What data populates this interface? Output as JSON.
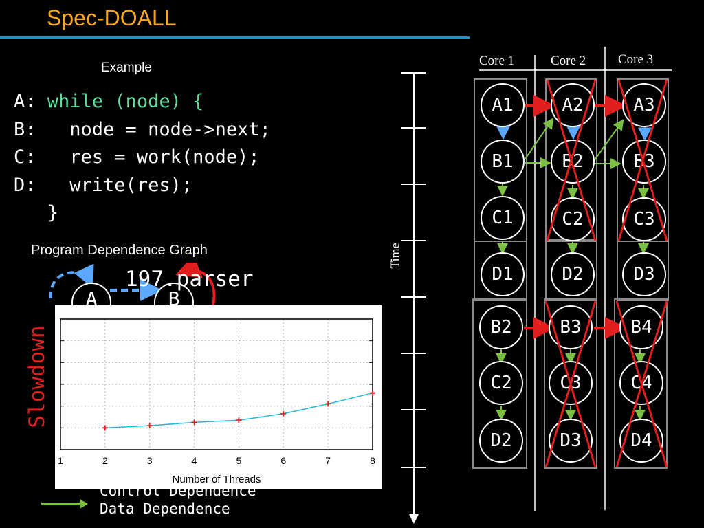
{
  "slide": {
    "title": "Spec-DOALL",
    "example_label": "Example",
    "code": {
      "line_a_prefix": "A: ",
      "line_a_code": "while (node) {",
      "line_b": "B:   node = node->next;",
      "line_c": "C:   res = work(node);",
      "line_d": "D:   write(res);",
      "line_close": "   }"
    },
    "pdg_label": "Program Dependence Graph",
    "pdg_nodes": [
      "A",
      "B"
    ],
    "chart_title": "197.parser",
    "legend": {
      "control": "Control Dependence",
      "data": "Data Dependence"
    },
    "time_label": "Time",
    "cores": [
      "Core 1",
      "Core 2",
      "Core 3"
    ],
    "nodes_top": [
      [
        "A1",
        "B1",
        "C1",
        "D1"
      ],
      [
        "A2",
        "B2",
        "C2",
        "D2"
      ],
      [
        "A3",
        "B3",
        "C3",
        "D3"
      ]
    ],
    "nodes_bottom": [
      [
        "B2",
        "C2",
        "D2"
      ],
      [
        "B3",
        "C3",
        "D3"
      ],
      [
        "B4",
        "C4",
        "D4"
      ]
    ]
  },
  "colors": {
    "title": "#f5a623",
    "rule": "#1f8fd6",
    "code_highlight": "#5fdc9c",
    "misspec": "#e01e1e",
    "data_dep": "#7bc043",
    "control_dep": "#5aa8ff",
    "chart_line": "#22b8d8"
  },
  "chart_data": {
    "type": "line",
    "title": "197.parser",
    "xlabel": "Number of Threads",
    "ylabel": "Slowdown",
    "xticks": [
      "1",
      "2",
      "3",
      "4",
      "5",
      "6",
      "7",
      "8"
    ],
    "xlim": [
      1,
      8
    ],
    "ylim": [
      0,
      6
    ],
    "grid": true,
    "series": [
      {
        "x": [
          2,
          3,
          4,
          5,
          6,
          7,
          8
        ],
        "y": [
          1.0,
          1.1,
          1.25,
          1.35,
          1.65,
          2.1,
          2.6
        ]
      }
    ]
  }
}
